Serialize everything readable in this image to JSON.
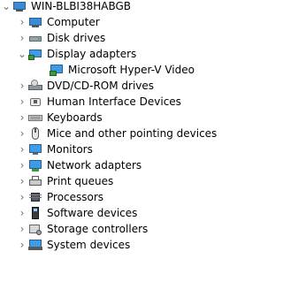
{
  "root": {
    "label": "WIN-BLBI38HABGB",
    "expanded": true,
    "icon": "computer-icon"
  },
  "items": [
    {
      "label": "Computer",
      "icon": "computer-icon",
      "expanded": false
    },
    {
      "label": "Disk drives",
      "icon": "disk-drive-icon",
      "expanded": false
    },
    {
      "label": "Display adapters",
      "icon": "display-adapter-icon",
      "expanded": true,
      "children": [
        {
          "label": "Microsoft Hyper-V Video",
          "icon": "video-adapter-icon"
        }
      ]
    },
    {
      "label": "DVD/CD-ROM drives",
      "icon": "dvd-drive-icon",
      "expanded": false
    },
    {
      "label": "Human Interface Devices",
      "icon": "hid-icon",
      "expanded": false
    },
    {
      "label": "Keyboards",
      "icon": "keyboard-icon",
      "expanded": false
    },
    {
      "label": "Mice and other pointing devices",
      "icon": "mouse-icon",
      "expanded": false
    },
    {
      "label": "Monitors",
      "icon": "monitor-icon",
      "expanded": false
    },
    {
      "label": "Network adapters",
      "icon": "network-adapter-icon",
      "expanded": false
    },
    {
      "label": "Print queues",
      "icon": "printer-icon",
      "expanded": false
    },
    {
      "label": "Processors",
      "icon": "processor-icon",
      "expanded": false
    },
    {
      "label": "Software devices",
      "icon": "software-device-icon",
      "expanded": false
    },
    {
      "label": "Storage controllers",
      "icon": "storage-controller-icon",
      "expanded": false
    },
    {
      "label": "System devices",
      "icon": "system-device-icon",
      "expanded": false
    }
  ]
}
